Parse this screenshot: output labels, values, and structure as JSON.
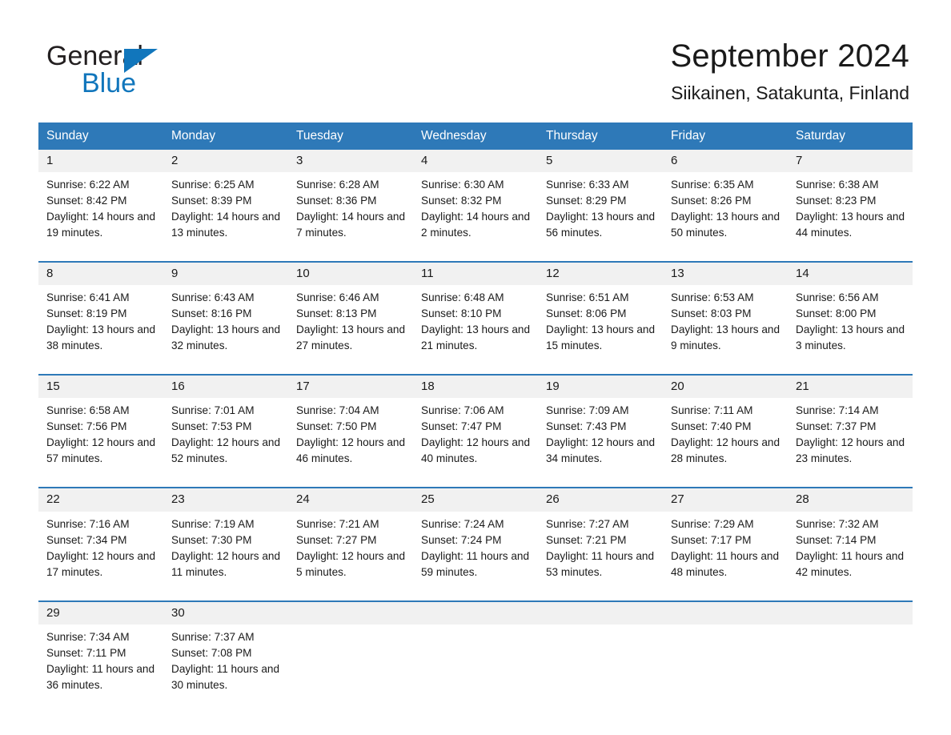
{
  "brand": {
    "name_part1": "General",
    "name_part2": "Blue",
    "accent_color": "#1176bc"
  },
  "header": {
    "month_title": "September 2024",
    "location": "Siikainen, Satakunta, Finland"
  },
  "calendar": {
    "header_bg": "#2e79b8",
    "daynum_bg": "#f1f1f1",
    "weekday_headers": [
      "Sunday",
      "Monday",
      "Tuesday",
      "Wednesday",
      "Thursday",
      "Friday",
      "Saturday"
    ],
    "weeks": [
      {
        "days": [
          {
            "date": "1",
            "sunrise": "Sunrise: 6:22 AM",
            "sunset": "Sunset: 8:42 PM",
            "daylight": "Daylight: 14 hours and 19 minutes."
          },
          {
            "date": "2",
            "sunrise": "Sunrise: 6:25 AM",
            "sunset": "Sunset: 8:39 PM",
            "daylight": "Daylight: 14 hours and 13 minutes."
          },
          {
            "date": "3",
            "sunrise": "Sunrise: 6:28 AM",
            "sunset": "Sunset: 8:36 PM",
            "daylight": "Daylight: 14 hours and 7 minutes."
          },
          {
            "date": "4",
            "sunrise": "Sunrise: 6:30 AM",
            "sunset": "Sunset: 8:32 PM",
            "daylight": "Daylight: 14 hours and 2 minutes."
          },
          {
            "date": "5",
            "sunrise": "Sunrise: 6:33 AM",
            "sunset": "Sunset: 8:29 PM",
            "daylight": "Daylight: 13 hours and 56 minutes."
          },
          {
            "date": "6",
            "sunrise": "Sunrise: 6:35 AM",
            "sunset": "Sunset: 8:26 PM",
            "daylight": "Daylight: 13 hours and 50 minutes."
          },
          {
            "date": "7",
            "sunrise": "Sunrise: 6:38 AM",
            "sunset": "Sunset: 8:23 PM",
            "daylight": "Daylight: 13 hours and 44 minutes."
          }
        ]
      },
      {
        "days": [
          {
            "date": "8",
            "sunrise": "Sunrise: 6:41 AM",
            "sunset": "Sunset: 8:19 PM",
            "daylight": "Daylight: 13 hours and 38 minutes."
          },
          {
            "date": "9",
            "sunrise": "Sunrise: 6:43 AM",
            "sunset": "Sunset: 8:16 PM",
            "daylight": "Daylight: 13 hours and 32 minutes."
          },
          {
            "date": "10",
            "sunrise": "Sunrise: 6:46 AM",
            "sunset": "Sunset: 8:13 PM",
            "daylight": "Daylight: 13 hours and 27 minutes."
          },
          {
            "date": "11",
            "sunrise": "Sunrise: 6:48 AM",
            "sunset": "Sunset: 8:10 PM",
            "daylight": "Daylight: 13 hours and 21 minutes."
          },
          {
            "date": "12",
            "sunrise": "Sunrise: 6:51 AM",
            "sunset": "Sunset: 8:06 PM",
            "daylight": "Daylight: 13 hours and 15 minutes."
          },
          {
            "date": "13",
            "sunrise": "Sunrise: 6:53 AM",
            "sunset": "Sunset: 8:03 PM",
            "daylight": "Daylight: 13 hours and 9 minutes."
          },
          {
            "date": "14",
            "sunrise": "Sunrise: 6:56 AM",
            "sunset": "Sunset: 8:00 PM",
            "daylight": "Daylight: 13 hours and 3 minutes."
          }
        ]
      },
      {
        "days": [
          {
            "date": "15",
            "sunrise": "Sunrise: 6:58 AM",
            "sunset": "Sunset: 7:56 PM",
            "daylight": "Daylight: 12 hours and 57 minutes."
          },
          {
            "date": "16",
            "sunrise": "Sunrise: 7:01 AM",
            "sunset": "Sunset: 7:53 PM",
            "daylight": "Daylight: 12 hours and 52 minutes."
          },
          {
            "date": "17",
            "sunrise": "Sunrise: 7:04 AM",
            "sunset": "Sunset: 7:50 PM",
            "daylight": "Daylight: 12 hours and 46 minutes."
          },
          {
            "date": "18",
            "sunrise": "Sunrise: 7:06 AM",
            "sunset": "Sunset: 7:47 PM",
            "daylight": "Daylight: 12 hours and 40 minutes."
          },
          {
            "date": "19",
            "sunrise": "Sunrise: 7:09 AM",
            "sunset": "Sunset: 7:43 PM",
            "daylight": "Daylight: 12 hours and 34 minutes."
          },
          {
            "date": "20",
            "sunrise": "Sunrise: 7:11 AM",
            "sunset": "Sunset: 7:40 PM",
            "daylight": "Daylight: 12 hours and 28 minutes."
          },
          {
            "date": "21",
            "sunrise": "Sunrise: 7:14 AM",
            "sunset": "Sunset: 7:37 PM",
            "daylight": "Daylight: 12 hours and 23 minutes."
          }
        ]
      },
      {
        "days": [
          {
            "date": "22",
            "sunrise": "Sunrise: 7:16 AM",
            "sunset": "Sunset: 7:34 PM",
            "daylight": "Daylight: 12 hours and 17 minutes."
          },
          {
            "date": "23",
            "sunrise": "Sunrise: 7:19 AM",
            "sunset": "Sunset: 7:30 PM",
            "daylight": "Daylight: 12 hours and 11 minutes."
          },
          {
            "date": "24",
            "sunrise": "Sunrise: 7:21 AM",
            "sunset": "Sunset: 7:27 PM",
            "daylight": "Daylight: 12 hours and 5 minutes."
          },
          {
            "date": "25",
            "sunrise": "Sunrise: 7:24 AM",
            "sunset": "Sunset: 7:24 PM",
            "daylight": "Daylight: 11 hours and 59 minutes."
          },
          {
            "date": "26",
            "sunrise": "Sunrise: 7:27 AM",
            "sunset": "Sunset: 7:21 PM",
            "daylight": "Daylight: 11 hours and 53 minutes."
          },
          {
            "date": "27",
            "sunrise": "Sunrise: 7:29 AM",
            "sunset": "Sunset: 7:17 PM",
            "daylight": "Daylight: 11 hours and 48 minutes."
          },
          {
            "date": "28",
            "sunrise": "Sunrise: 7:32 AM",
            "sunset": "Sunset: 7:14 PM",
            "daylight": "Daylight: 11 hours and 42 minutes."
          }
        ]
      },
      {
        "days": [
          {
            "date": "29",
            "sunrise": "Sunrise: 7:34 AM",
            "sunset": "Sunset: 7:11 PM",
            "daylight": "Daylight: 11 hours and 36 minutes."
          },
          {
            "date": "30",
            "sunrise": "Sunrise: 7:37 AM",
            "sunset": "Sunset: 7:08 PM",
            "daylight": "Daylight: 11 hours and 30 minutes."
          },
          {
            "date": "",
            "sunrise": "",
            "sunset": "",
            "daylight": ""
          },
          {
            "date": "",
            "sunrise": "",
            "sunset": "",
            "daylight": ""
          },
          {
            "date": "",
            "sunrise": "",
            "sunset": "",
            "daylight": ""
          },
          {
            "date": "",
            "sunrise": "",
            "sunset": "",
            "daylight": ""
          },
          {
            "date": "",
            "sunrise": "",
            "sunset": "",
            "daylight": ""
          }
        ]
      }
    ]
  }
}
